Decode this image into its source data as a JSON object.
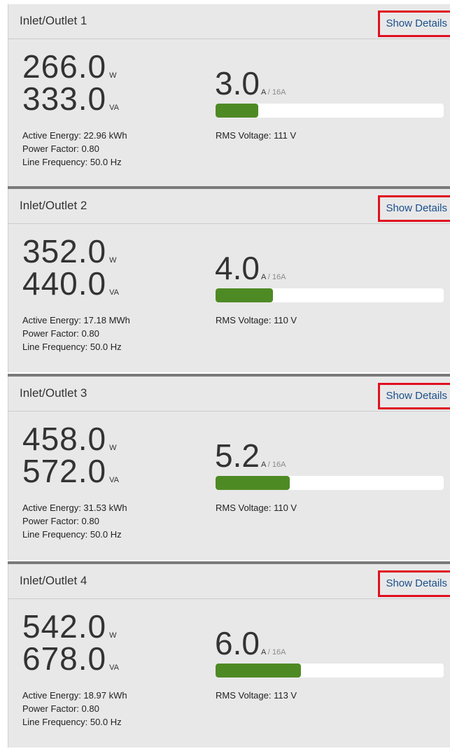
{
  "colors": {
    "panel_background": "#e8e8e8",
    "details_link": "#1a4f8a",
    "highlight_border": "#e01020",
    "bar_fill": "#4e8a24",
    "bar_track": "#ffffff"
  },
  "panels": [
    {
      "title": "Inlet/Outlet 1",
      "details_label": "Show Details",
      "active_power": "266.0",
      "active_power_unit": "W",
      "apparent_power": "333.0",
      "apparent_power_unit": "VA",
      "active_energy": "Active Energy: 22.96 kWh",
      "power_factor": "Power Factor: 0.80",
      "line_frequency": "Line Frequency: 50.0 Hz",
      "current": "3.0",
      "current_unit": "A",
      "current_limit": " / 16A",
      "current_fraction": 0.1875,
      "rms_voltage": "RMS Voltage: 111 V"
    },
    {
      "title": "Inlet/Outlet 2",
      "details_label": "Show Details",
      "active_power": "352.0",
      "active_power_unit": "W",
      "apparent_power": "440.0",
      "apparent_power_unit": "VA",
      "active_energy": "Active Energy: 17.18 MWh",
      "power_factor": "Power Factor: 0.80",
      "line_frequency": "Line Frequency: 50.0 Hz",
      "current": "4.0",
      "current_unit": "A",
      "current_limit": " / 16A",
      "current_fraction": 0.25,
      "rms_voltage": "RMS Voltage: 110 V"
    },
    {
      "title": "Inlet/Outlet 3",
      "details_label": "Show Details",
      "active_power": "458.0",
      "active_power_unit": "W",
      "apparent_power": "572.0",
      "apparent_power_unit": "VA",
      "active_energy": "Active Energy: 31.53 kWh",
      "power_factor": "Power Factor: 0.80",
      "line_frequency": "Line Frequency: 50.0 Hz",
      "current": "5.2",
      "current_unit": "A",
      "current_limit": " / 16A",
      "current_fraction": 0.325,
      "rms_voltage": "RMS Voltage: 110 V"
    },
    {
      "title": "Inlet/Outlet 4",
      "details_label": "Show Details",
      "active_power": "542.0",
      "active_power_unit": "W",
      "apparent_power": "678.0",
      "apparent_power_unit": "VA",
      "active_energy": "Active Energy: 18.97 kWh",
      "power_factor": "Power Factor: 0.80",
      "line_frequency": "Line Frequency: 50.0 Hz",
      "current": "6.0",
      "current_unit": "A",
      "current_limit": " / 16A",
      "current_fraction": 0.375,
      "rms_voltage": "RMS Voltage: 113 V"
    }
  ]
}
